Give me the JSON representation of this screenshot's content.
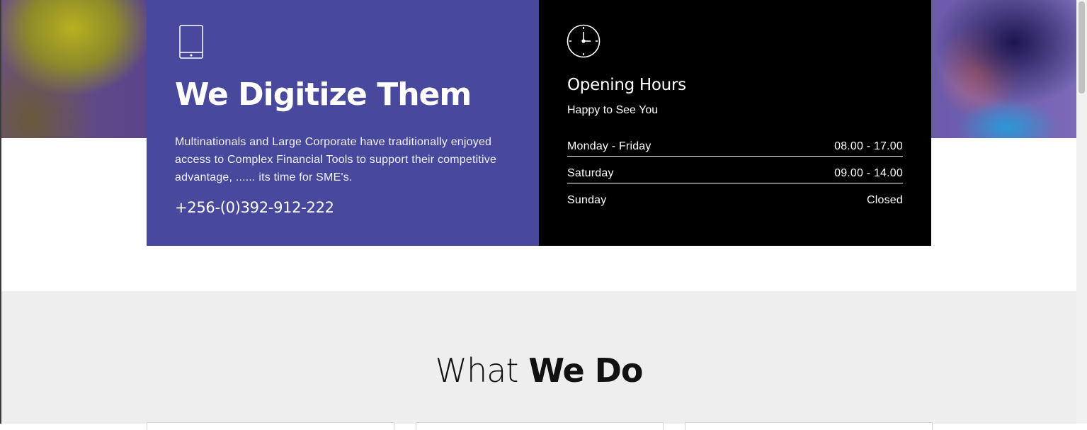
{
  "hero": {
    "background": "photo-collage"
  },
  "digitize": {
    "icon": "tablet-icon",
    "title": "We Digitize Them",
    "description": "Multinationals and Large Corporate have traditionally enjoyed access to Complex Financial Tools to support their competitive advantage, ...... its time for SME's.",
    "phone": "+256-(0)392-912-222",
    "color": "#48489c"
  },
  "hours": {
    "icon": "clock-icon",
    "title": "Opening Hours",
    "subtitle": "Happy to See You",
    "rows": [
      {
        "day": "Monday - Friday",
        "time": "08.00 - 17.00"
      },
      {
        "day": "Saturday",
        "time": "09.00 - 14.00"
      },
      {
        "day": "Sunday",
        "time": "Closed"
      }
    ],
    "color": "#000000"
  },
  "what_we_do": {
    "heading_light": "What",
    "heading_bold": "We Do",
    "background": "#eeeeee"
  }
}
